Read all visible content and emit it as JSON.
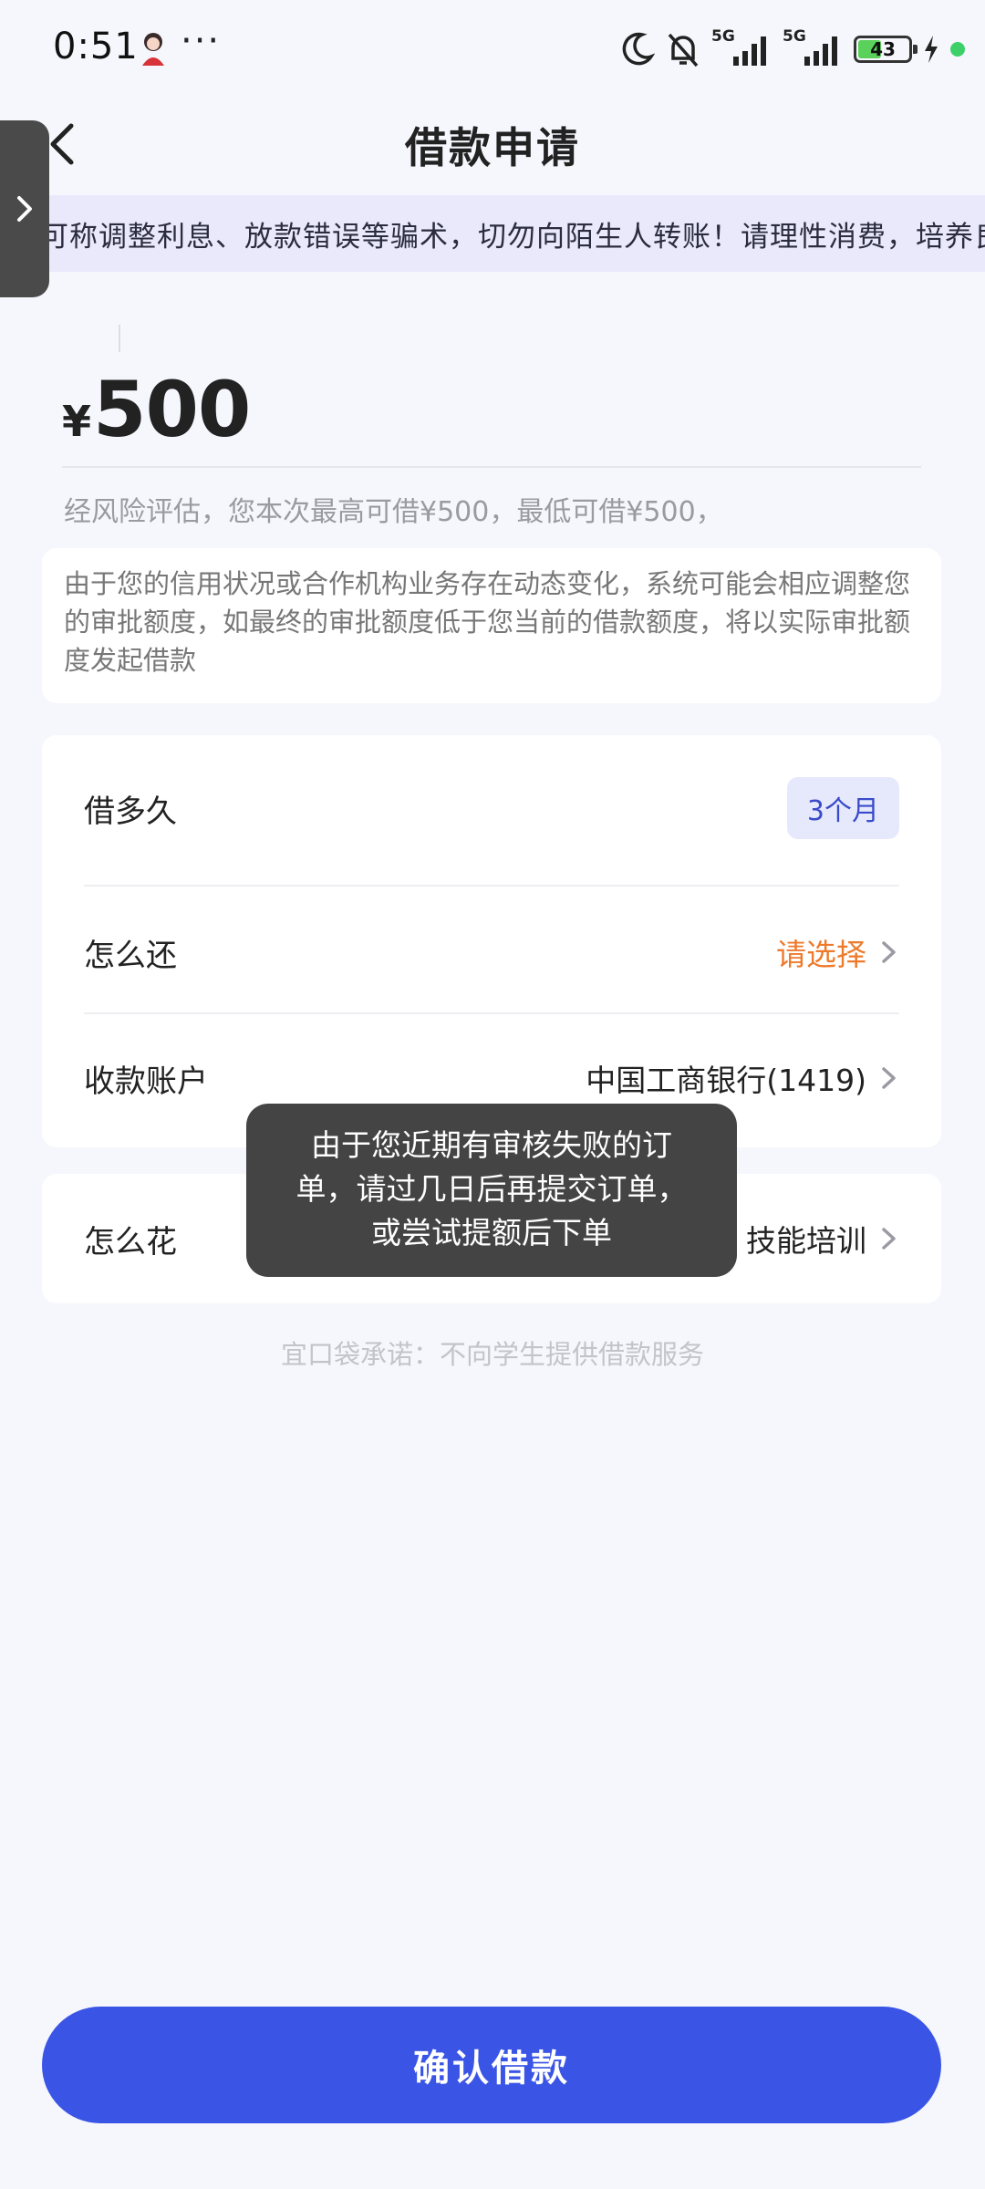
{
  "status_bar": {
    "time": "0:51",
    "dots": "···",
    "network_1": "5G",
    "network_2": "5G",
    "battery_level": "43",
    "accent_color": "#3dd068"
  },
  "nav": {
    "title": "借款申请"
  },
  "notice": {
    "text": "可称调整利息、放款错误等骗术，切勿向陌生人转账！请理性消费，培养良"
  },
  "amount": {
    "currency": "¥",
    "value": "500",
    "risk_text": "经风险评估，您本次最高可借¥500，最低可借¥500，"
  },
  "info_card": {
    "text": "由于您的信用状况或合作机构业务存在动态变化，系统可能会相应调整您的审批额度，如最终的审批额度低于您当前的借款额度，将以实际审批额度发起借款"
  },
  "form": {
    "term_label": "借多久",
    "term_value": "3个月",
    "repay_label": "怎么还",
    "repay_value": "请选择",
    "account_label": "收款账户",
    "account_value": "中国工商银行(1419)",
    "usage_label": "怎么花",
    "usage_value": "技能培训"
  },
  "promise": "宜口袋承诺：不向学生提供借款服务",
  "toast": {
    "text": "由于您近期有审核失败的订单，请过几日后再提交订单，或尝试提额后下单"
  },
  "confirm_button": "确认借款",
  "colors": {
    "primary": "#3a55e5",
    "orange": "#ee7a2c",
    "badge_bg": "#e6e9fb",
    "notice_bg": "#e9e9fb"
  }
}
